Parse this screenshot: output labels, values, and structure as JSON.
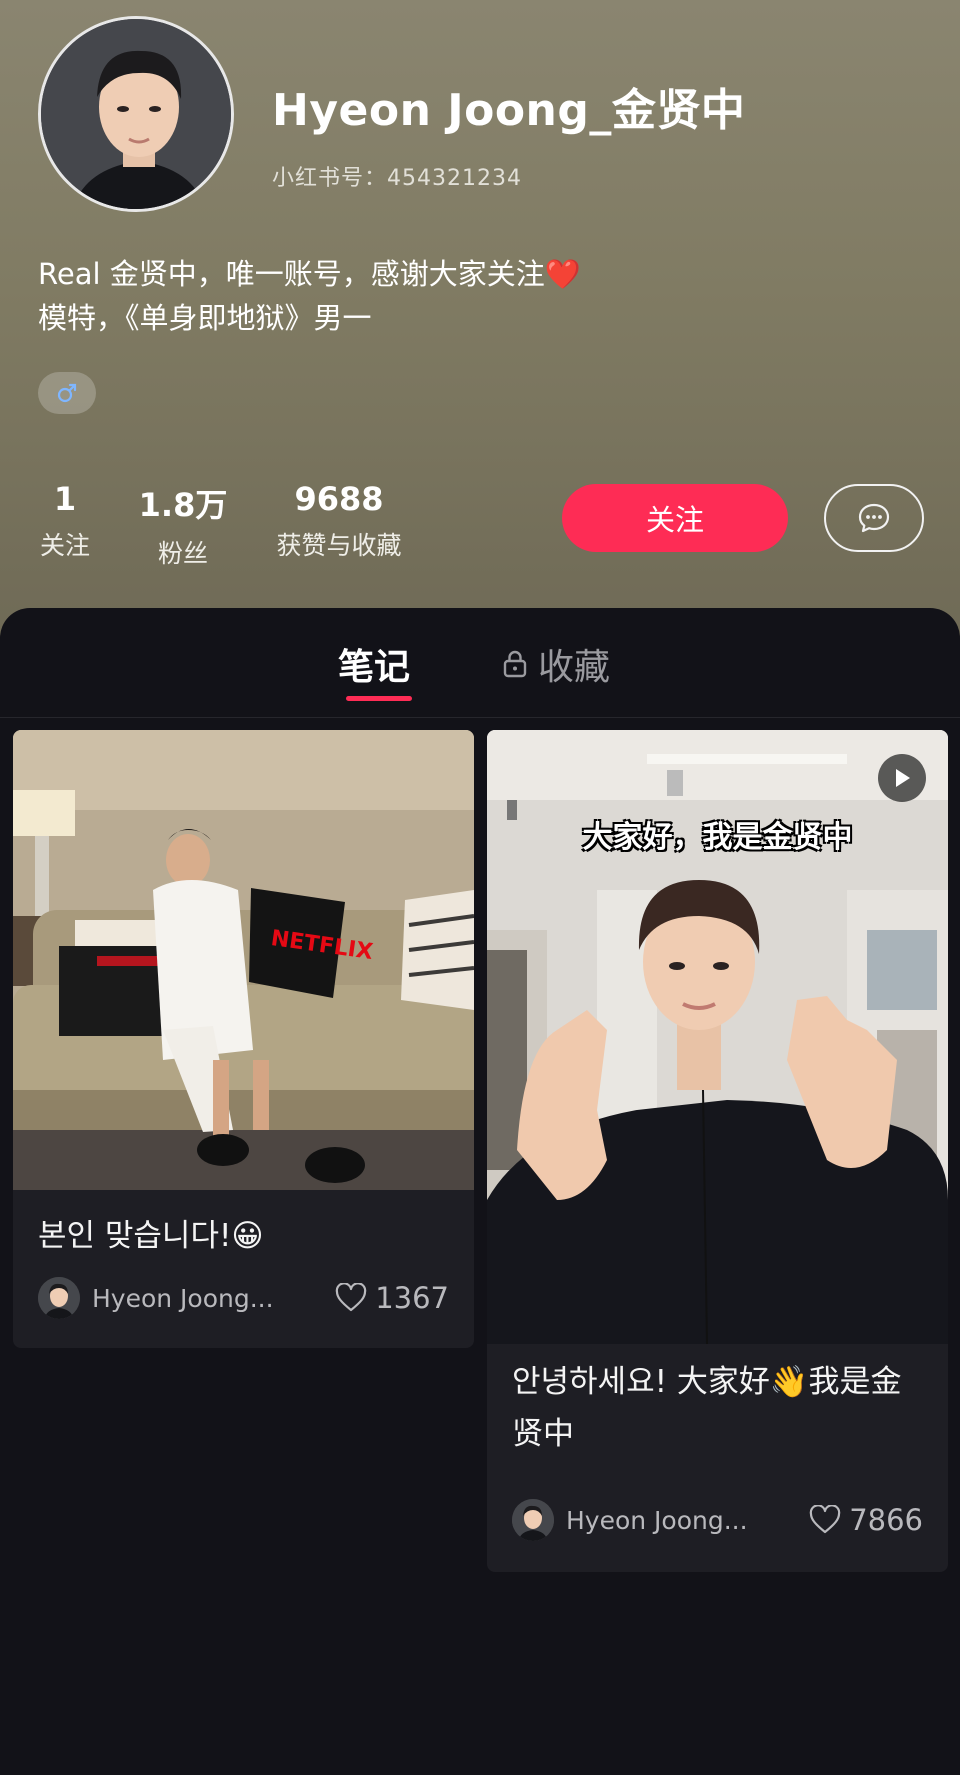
{
  "profile": {
    "name": "Hyeon Joong_金贤中",
    "user_id": "小红书号：454321234",
    "bio_line1": "Real 金贤中，唯一账号，感谢大家关注",
    "bio_line1_emoji": "❤️",
    "bio_line2": "模特，《单身即地狱》男一",
    "gender_icon": "male-symbol-icon",
    "stats": [
      {
        "value": "1",
        "label": "关注"
      },
      {
        "value": "1.8万",
        "label": "粉丝"
      },
      {
        "value": "9688",
        "label": "获赞与收藏"
      }
    ],
    "follow_label": "关注",
    "message_icon": "chat-bubble-icon"
  },
  "tabs": {
    "notes_label": "笔记",
    "collections_label": "收藏",
    "lock_icon": "lock-icon"
  },
  "notes": [
    {
      "title": "본인 맞습니다!😀",
      "author": "Hyeon Joong...",
      "likes": "1367",
      "is_video": false
    },
    {
      "title": "안녕하세요! 大家好👋我是金贤中",
      "overlay_text": "大家好，我是金贤中",
      "author": "Hyeon Joong...",
      "likes": "7866",
      "is_video": true
    }
  ],
  "colors": {
    "accent": "#fe2c55",
    "panel_bg": "#121218",
    "card_bg": "#1e1e24",
    "header_bg": "#837e66"
  }
}
